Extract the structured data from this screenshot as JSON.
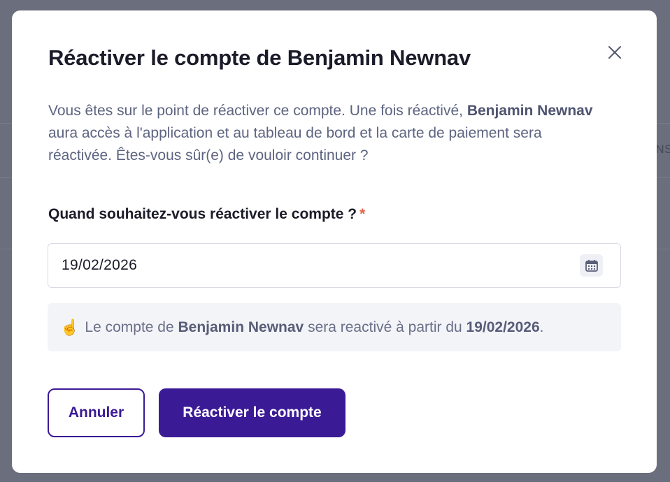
{
  "background": {
    "fragment_text": "NS"
  },
  "modal": {
    "title": "Réactiver le compte de Benjamin Newnav",
    "close_icon": "close-icon",
    "description": {
      "part1": "Vous êtes sur le point de réactiver ce compte. Une fois réactivé, ",
      "name": "Benjamin Newnav",
      "part2": " aura accès à l'application et au tableau de bord et la carte de paiement sera réactivée. Êtes-vous sûr(e) de vouloir continuer ?"
    },
    "question": {
      "label": "Quand souhaitez-vous réactiver le compte ?",
      "required_marker": "*"
    },
    "date_input": {
      "value": "19/02/2026",
      "icon": "calendar-icon"
    },
    "info": {
      "emoji": "☝️",
      "part1": "Le compte de ",
      "name": "Benjamin Newnav",
      "part2": " sera reactivé à partir du ",
      "date": "19/02/2026",
      "part3": "."
    },
    "buttons": {
      "cancel_label": "Annuler",
      "confirm_label": "Réactiver le compte"
    }
  },
  "colors": {
    "primary": "#3b1a96",
    "required": "#e0664d",
    "overlay": "#6b6e7c"
  }
}
